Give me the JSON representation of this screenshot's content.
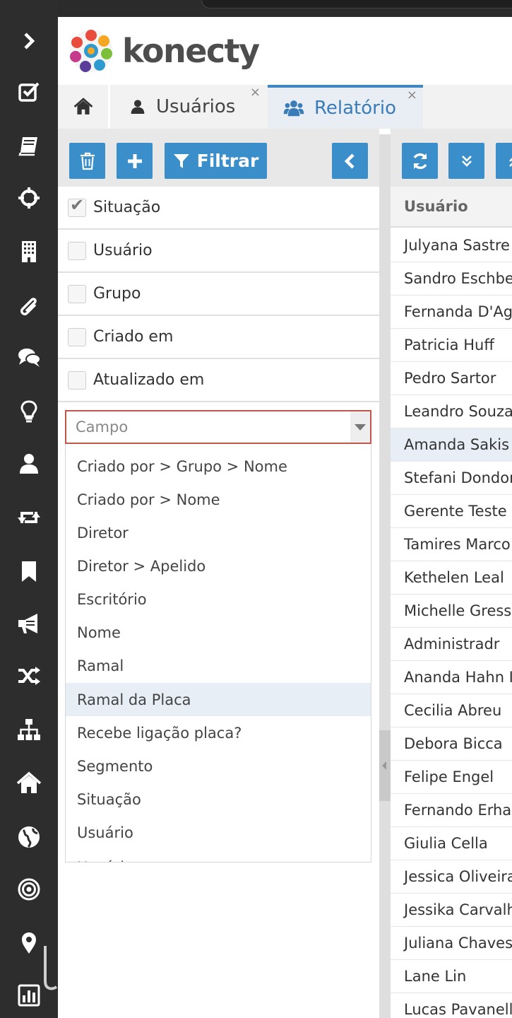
{
  "app": {
    "logo_text": "konecty"
  },
  "sidebar": {
    "icons": [
      "chevron-right-icon",
      "checkbox-icon",
      "book-icon",
      "crosshair-icon",
      "building-icon",
      "paperclip-icon",
      "comments-icon",
      "lightbulb-icon",
      "user-icon",
      "retweet-icon",
      "bookmark-icon",
      "bullhorn-icon",
      "random-icon",
      "sitemap-icon",
      "home-icon",
      "globe-icon",
      "target-icon",
      "map-marker-icon",
      "bar-chart-icon"
    ]
  },
  "tabs": [
    {
      "label": "",
      "icon": "home-icon"
    },
    {
      "label": "Usuários",
      "icon": "user-icon",
      "close": "×"
    },
    {
      "label": "Relatório",
      "icon": "users-icon",
      "close": "×",
      "active": true
    }
  ],
  "toolbar": {
    "filter_label": "Filtrar"
  },
  "filters": [
    {
      "label": "Situação",
      "checked": true
    },
    {
      "label": "Usuário",
      "checked": false
    },
    {
      "label": "Grupo",
      "checked": false
    },
    {
      "label": "Criado em",
      "checked": false
    },
    {
      "label": "Atualizado em",
      "checked": false
    }
  ],
  "field_select": {
    "placeholder": "Campo",
    "options": [
      "Criado por > Grupo > Nome",
      "Criado por > Nome",
      "Diretor",
      "Diretor > Apelido",
      "Escritório",
      "Nome",
      "Ramal",
      "Ramal da Placa",
      "Recebe ligação placa?",
      "Segmento",
      "Situação",
      "Usuário",
      "Usuário > ..."
    ],
    "highlighted": "Ramal da Placa"
  },
  "table": {
    "header": "Usuário",
    "rows": [
      "Julyana Sastre",
      "Sandro Eschbe",
      "Fernanda D'Ag",
      "Patricia Huff",
      "Pedro Sartor",
      "Leandro Souza",
      "Amanda Sakis",
      "Stefani Dondor",
      "Gerente Teste",
      "Tamires Marco",
      "Kethelen Leal",
      "Michelle Gress",
      "Administradr",
      "Ananda Hahn I",
      "Cecilia Abreu",
      "Debora Bicca",
      "Felipe Engel",
      "Fernando Erha",
      "Giulia Cella",
      "Jessica Oliveira",
      "Jessika Carvalh",
      "Juliana Chaves",
      "Lane Lin",
      "Lucas Pavanell"
    ],
    "highlighted_row": "Amanda Sakis"
  },
  "colors": {
    "accent": "#3a8ec9",
    "sidebar": "#2d2d2d",
    "select_border": "#c0584a",
    "highlight": "#e8eef5"
  }
}
